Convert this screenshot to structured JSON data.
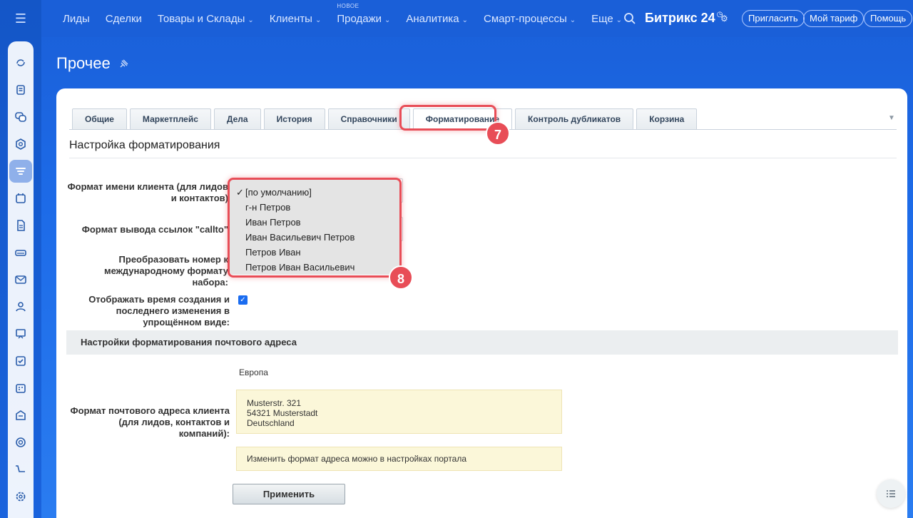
{
  "topnav": {
    "items": [
      {
        "label": "Лиды",
        "chevron": false
      },
      {
        "label": "Сделки",
        "chevron": false
      },
      {
        "label": "Товары и Склады",
        "chevron": true
      },
      {
        "label": "Клиенты",
        "chevron": true
      },
      {
        "label": "Продажи",
        "chevron": true,
        "badge": "НОВОЕ"
      },
      {
        "label": "Аналитика",
        "chevron": true
      },
      {
        "label": "Смарт-процессы",
        "chevron": true
      },
      {
        "label": "Еще",
        "chevron": true
      }
    ],
    "brand": "Битрикс 24",
    "invite": "Пригласить",
    "tariff": "Мой тариф",
    "help": "Помощь"
  },
  "page": {
    "title": "Прочее"
  },
  "tabs": [
    "Общие",
    "Маркетплейс",
    "Дела",
    "История",
    "Справочники",
    "Форматирование",
    "Контроль дубликатов",
    "Корзина"
  ],
  "active_tab": "Форматирование",
  "annotations": {
    "tab_badge": "7",
    "dropdown_badge": "8"
  },
  "form": {
    "section_title": "Настройка форматирования",
    "client_name_label_line1": "Формат имени клиента (для лидов",
    "client_name_label_line2": "и контактов)",
    "callto_label": "Формат вывода ссылок \"callto\"",
    "phone_label_line1": "Преобразовать номер к",
    "phone_label_line2": "международному формату",
    "phone_label_line3": "набора:",
    "time_label_line1": "Отображать время создания и",
    "time_label_line2": "последнего изменения в",
    "time_label_line3": "упрощённом виде:",
    "name_format_options": [
      "[по умолчанию]",
      "г-н Петров",
      "Иван Петров",
      "Иван Васильевич Петров",
      "Петров Иван",
      "Петров Иван Васильевич"
    ],
    "selected_option": "[по умолчанию]",
    "check_mark": "✓",
    "time_checked": true
  },
  "address": {
    "band_title": "Настройки форматирования почтового адреса",
    "region": "Европа",
    "label_line1": "Формат почтового адреса клиента",
    "label_line2": "(для лидов, контактов и",
    "label_line3": "компаний):",
    "sample_line1": "Musterstr. 321",
    "sample_line2": "54321 Musterstadt",
    "sample_line3": "Deutschland",
    "note": "Изменить формат адреса можно в настройках портала"
  },
  "apply_button": "Применить",
  "colors": {
    "accent": "#1a6cf0",
    "highlight": "#e84d57"
  }
}
